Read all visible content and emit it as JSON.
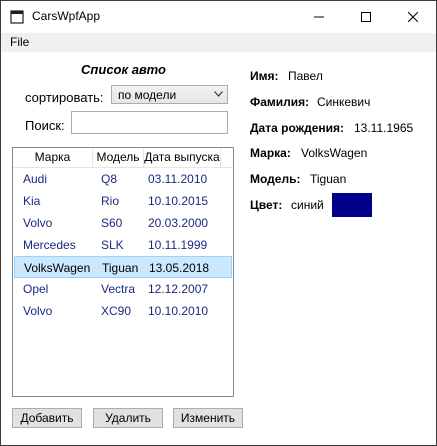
{
  "window": {
    "title": "CarsWpfApp"
  },
  "menu": {
    "file": "File"
  },
  "list": {
    "title": "Список авто",
    "sort_label": "сортировать:",
    "sort_value": "по модели",
    "search_label": "Поиск:",
    "search_value": "",
    "columns": [
      "Марка",
      "Модель",
      "Дата выпуска"
    ],
    "rows": [
      {
        "make": "Audi",
        "model": "Q8",
        "date": "03.11.2010"
      },
      {
        "make": "Kia",
        "model": "Rio",
        "date": "10.10.2015"
      },
      {
        "make": "Volvo",
        "model": "S60",
        "date": "20.03.2000"
      },
      {
        "make": "Mercedes",
        "model": "SLK",
        "date": "10.11.1999"
      },
      {
        "make": "VolksWagen",
        "model": "Tiguan",
        "date": "13.05.2018"
      },
      {
        "make": "Opel",
        "model": "Vectra",
        "date": "12.12.2007"
      },
      {
        "make": "Volvo",
        "model": "XC90",
        "date": "10.10.2010"
      }
    ],
    "selected_index": 4
  },
  "buttons": {
    "add": "Добавить",
    "delete": "Удалить",
    "edit": "Изменить"
  },
  "details": {
    "name_label": "Имя:",
    "name": "Павел",
    "surname_label": "Фамилия:",
    "surname": "Синкевич",
    "birth_label": "Дата рождения:",
    "birth": "13.11.1965",
    "make_label": "Марка:",
    "make": "VolksWagen",
    "model_label": "Модель:",
    "model": "Tiguan",
    "color_label": "Цвет:",
    "color": "синий",
    "color_hex": "#00008b"
  },
  "icons": {
    "app": "app-icon",
    "minimize": "minimize-icon",
    "maximize": "maximize-icon",
    "close": "close-icon",
    "dropdown": "chevron-down-icon"
  }
}
